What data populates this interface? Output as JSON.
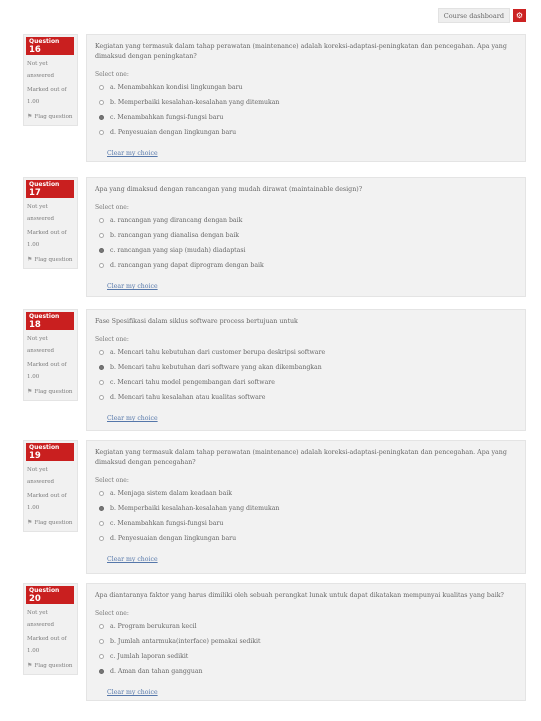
{
  "header": {
    "course_dashboard_label": "Course dashboard",
    "gear_icon": "gear-icon",
    "accent_color": "#c91f1f"
  },
  "questions": [
    {
      "label": "Question",
      "number": "16",
      "state": "Not yet answered",
      "grade": "Marked out of 1.00",
      "flag": "Flag question",
      "text": "Kegiatan yang termasuk dalam tahap perawatan (maintenance) adalah koreksi-adaptasi-peningkatan dan pencegahan. Apa yang dimaksud dengan peningkatan?",
      "prompt": "Select one:",
      "options": [
        "a. Menambahkan kondisi lingkungan baru",
        "b. Memperbaiki kesalahan-kesalahan yang ditemukan",
        "c. Menambahkan fungsi-fungsi baru",
        "d. Penyesuaian dengan lingkungan baru"
      ],
      "selected": 2,
      "clear": "Clear my choice"
    },
    {
      "label": "Question",
      "number": "17",
      "state": "Not yet answered",
      "grade": "Marked out of 1.00",
      "flag": "Flag question",
      "text": "Apa yang dimaksud dengan rancangan yang mudah dirawat (maintainable design)?",
      "prompt": "Select one:",
      "options": [
        "a. rancangan yang dirancang dengan baik",
        "b. rancangan yang dianalisa dengan baik",
        "c. rancangan yang siap (mudah) diadaptasi",
        "d. rancangan yang dapat diprogram dengan baik"
      ],
      "selected": 2,
      "clear": "Clear my choice"
    },
    {
      "label": "Question",
      "number": "18",
      "state": "Not yet answered",
      "grade": "Marked out of 1.00",
      "flag": "Flag question",
      "text": "Fase Spesifikasi dalam siklus software process bertujuan untuk",
      "prompt": "Select one:",
      "options": [
        "a. Mencari tahu kebutuhan dari customer berupa deskripsi software",
        "b. Mencari tahu kebutuhan dari software yang akan dikembangkan",
        "c. Mencari tahu model pengembangan dari software",
        "d. Mencari tahu kesalahan atau kualitas software"
      ],
      "selected": 1,
      "clear": "Clear my choice"
    },
    {
      "label": "Question",
      "number": "19",
      "state": "Not yet answered",
      "grade": "Marked out of 1.00",
      "flag": "Flag question",
      "text": "Kegiatan yang termasuk dalam tahap perawatan (maintenance) adalah koreksi-adaptasi-peningkatan dan pencegahan. Apa yang dimaksud dengan pencegahan?",
      "prompt": "Select one:",
      "options": [
        "a. Menjaga sistem dalam keadaan baik",
        "b. Memperbaiki kesalahan-kesalahan yang ditemukan",
        "c. Menambahkan fungsi-fungsi baru",
        "d. Penyesuaian dengan lingkungan baru"
      ],
      "selected": 1,
      "clear": "Clear my choice"
    },
    {
      "label": "Question",
      "number": "20",
      "state": "Not yet answered",
      "grade": "Marked out of 1.00",
      "flag": "Flag question",
      "text": "Apa diantaranya faktor yang harus dimiliki oleh sebuah perangkat lunak untuk dapat dikatakan mempunyai kualitas yang baik?",
      "prompt": "Select one:",
      "options": [
        "a. Program berukuran kecil",
        "b. Jumlah antarmuka(interface) pemakai sedikit",
        "c. Jumlah laporan sedikit",
        "d. Aman dan tahan gangguan"
      ],
      "selected": 3,
      "clear": "Clear my choice"
    }
  ]
}
